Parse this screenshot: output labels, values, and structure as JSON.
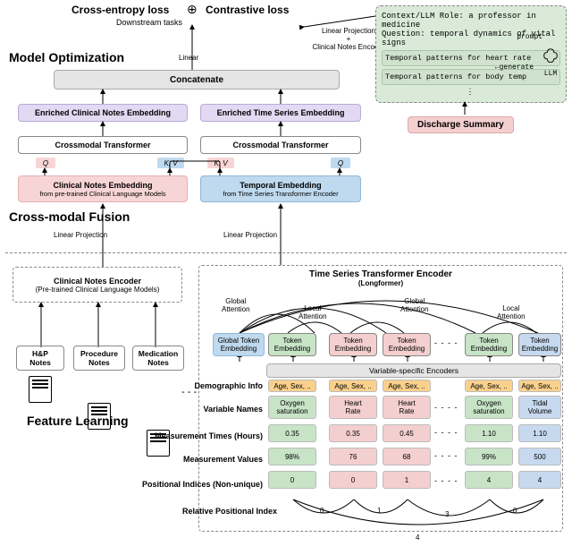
{
  "top": {
    "loss_left": "Cross-entropy loss",
    "loss_right": "Contrastive loss",
    "plus": "⊕",
    "downstream": "Downstream tasks",
    "model_opt": "Model Optimization",
    "linear": "Linear",
    "concatenate": "Concatenate",
    "enriched_notes": "Enriched Clinical Notes Embedding",
    "enriched_ts": "Enriched Time Series Embedding",
    "crossmodal": "Crossmodal Transformer",
    "notes_embed": "Clinical Notes Embedding",
    "notes_embed_sub": "from pre-trained Clinical Language Models",
    "temp_embed": "Temporal Embedding",
    "temp_embed_sub": "from Time Series Transformer Encoder",
    "crossmodal_fusion": "Cross-modal Fusion",
    "linproj": "Linear Projection",
    "linproj_notes": "Linear Projection\n+\nClinical Notes Encoder",
    "q": "Q",
    "kv": "K, V"
  },
  "prompt": {
    "ctx": "Context/LLM Role: a professor in medicine",
    "question": "Question: temporal dynamics of vital signs",
    "p1": "Temporal patterns for heart rate",
    "p2": "Temporal patterns for body temp",
    "prompt_label": "prompt",
    "generate_label": "generate",
    "llm_label": "LLM",
    "discharge": "Discharge Summary"
  },
  "encoders": {
    "notes_encoder": "Clinical Notes Encoder",
    "notes_encoder_sub": "(Pre-trained Clinical Language Models)",
    "ts_encoder_title": "Time Series Transformer Encoder",
    "ts_encoder_sub": "(Longformer)",
    "global_attn": "Global\nAttention",
    "local_attn": "Local\nAttention",
    "global_tok": "Global Token\nEmbedding",
    "tok": "Token\nEmbedding",
    "var_enc": "Variable-specific Encoders"
  },
  "notes_types": {
    "hp": "H&P\nNotes",
    "proc": "Procedure\nNotes",
    "med": "Medication\nNotes"
  },
  "feature_learning": "Feature Learning",
  "table": {
    "rows": [
      "Demographic Info",
      "Variable Names",
      "Measurement Times (Hours)",
      "Measurement Values",
      "Positional Indices (Non-unique)",
      "Relative Positional Index"
    ],
    "demo": "Age, Sex, ..",
    "vars": [
      "Oxygen\nsaturation",
      "Heart\nRate",
      "Heart\nRate",
      "Oxygen\nsaturation",
      "Tidal\nVolume"
    ],
    "times": [
      "0.35",
      "0.35",
      "0.45",
      "1.10",
      "1.10"
    ],
    "vals": [
      "98%",
      "76",
      "68",
      "99%",
      "500"
    ],
    "pos": [
      "0",
      "0",
      "1",
      "4",
      "4"
    ],
    "rel": [
      "0",
      "1",
      "3",
      "0"
    ],
    "rel_total": "4"
  }
}
